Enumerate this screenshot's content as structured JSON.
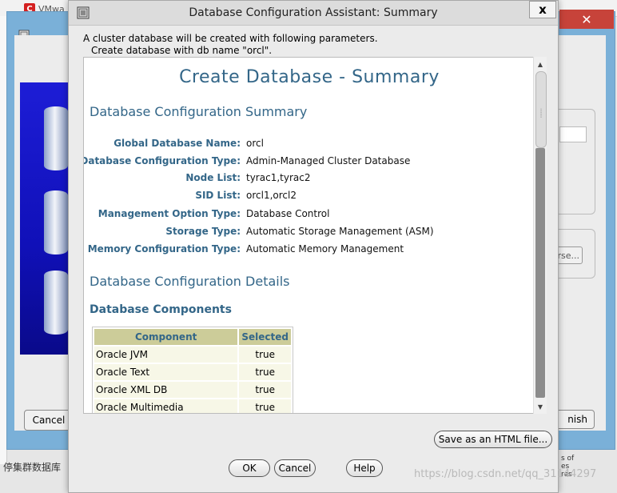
{
  "background": {
    "tab_label": "VMwa",
    "tab_logo": "C",
    "cancel_label": "Cancel",
    "finish_label": "nish",
    "browse_label": "rse...",
    "bottom_left_text": "停集群数据库",
    "right_text_1": "s of",
    "right_text_2": "es",
    "right_text_3": "res",
    "watermark": "https://blog.csdn.net/qq_31144297",
    "close_symbol": "✕"
  },
  "dialog": {
    "title": "Database Configuration Assistant: Summary",
    "close_symbol": "x",
    "intro_line1": "A cluster database will be created with following parameters.",
    "intro_line2": "Create database with db name \"orcl\".",
    "heading": "Create Database - Summary",
    "section_summary": "Database Configuration Summary",
    "summary_rows": [
      {
        "key": "Global Database Name:",
        "value": "orcl"
      },
      {
        "key": "Database Configuration Type:",
        "value": "Admin-Managed Cluster Database"
      },
      {
        "key": "Node List:",
        "value": "tyrac1,tyrac2"
      },
      {
        "key": "SID List:",
        "value": "orcl1,orcl2"
      },
      {
        "key": "Management Option Type:",
        "value": "Database Control"
      },
      {
        "key": "Storage Type:",
        "value": "Automatic Storage Management (ASM)"
      },
      {
        "key": "Memory Configuration Type:",
        "value": "Automatic Memory Management"
      }
    ],
    "section_details": "Database Configuration Details",
    "section_components": "Database Components",
    "components_table": {
      "headers": [
        "Component",
        "Selected"
      ],
      "rows": [
        [
          "Oracle JVM",
          "true"
        ],
        [
          "Oracle Text",
          "true"
        ],
        [
          "Oracle XML DB",
          "true"
        ],
        [
          "Oracle Multimedia",
          "true"
        ]
      ]
    },
    "save_button": "Save as an HTML file...",
    "ok_button": "OK",
    "cancel_button": "Cancel",
    "help_button": "Help"
  },
  "icons": {
    "app_icon": "database-icon",
    "scroll_up": "▲",
    "scroll_down": "▼"
  }
}
